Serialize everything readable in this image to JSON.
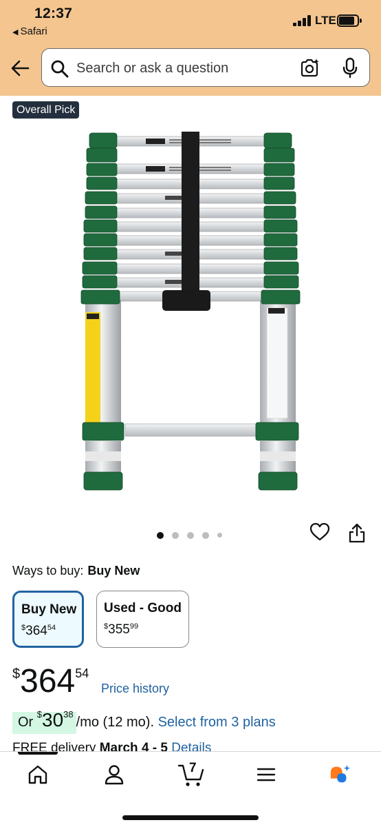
{
  "status_bar": {
    "time": "12:37",
    "back_app": "Safari",
    "network": "LTE"
  },
  "search": {
    "placeholder": "Search or ask a question"
  },
  "product": {
    "badge": "Overall Pick",
    "image_count": 5,
    "active_image": 0
  },
  "buy_options": {
    "label": "Ways to buy:",
    "selected_label": "Buy New",
    "options": [
      {
        "title": "Buy New",
        "currency": "$",
        "whole": "364",
        "fraction": "54",
        "selected": true
      },
      {
        "title": "Used - Good",
        "currency": "$",
        "whole": "355",
        "fraction": "99",
        "selected": false
      }
    ]
  },
  "price": {
    "currency": "$",
    "whole": "364",
    "fraction": "54",
    "history_link": "Price history"
  },
  "financing": {
    "prefix": "Or ",
    "currency": "$",
    "whole": "30",
    "fraction": "38",
    "term": "/mo (12 mo).",
    "link": "Select from 3 plans"
  },
  "delivery": {
    "prefix": "FREE delivery",
    "date": "March 4 - 5",
    "link": "Details"
  },
  "tabbar": {
    "cart_count": "7",
    "items": [
      "home-icon",
      "profile-icon",
      "cart-icon",
      "menu-icon",
      "ai-assistant-icon"
    ]
  },
  "colors": {
    "header_bg": "#f4c58f",
    "link": "#2162a1",
    "badge_bg": "#232f3e",
    "selected_border": "#2162a1",
    "financing_highlight": "#d3f7e3",
    "rufus_orange": "#ff7a1a",
    "rufus_blue": "#1f7ae0"
  }
}
